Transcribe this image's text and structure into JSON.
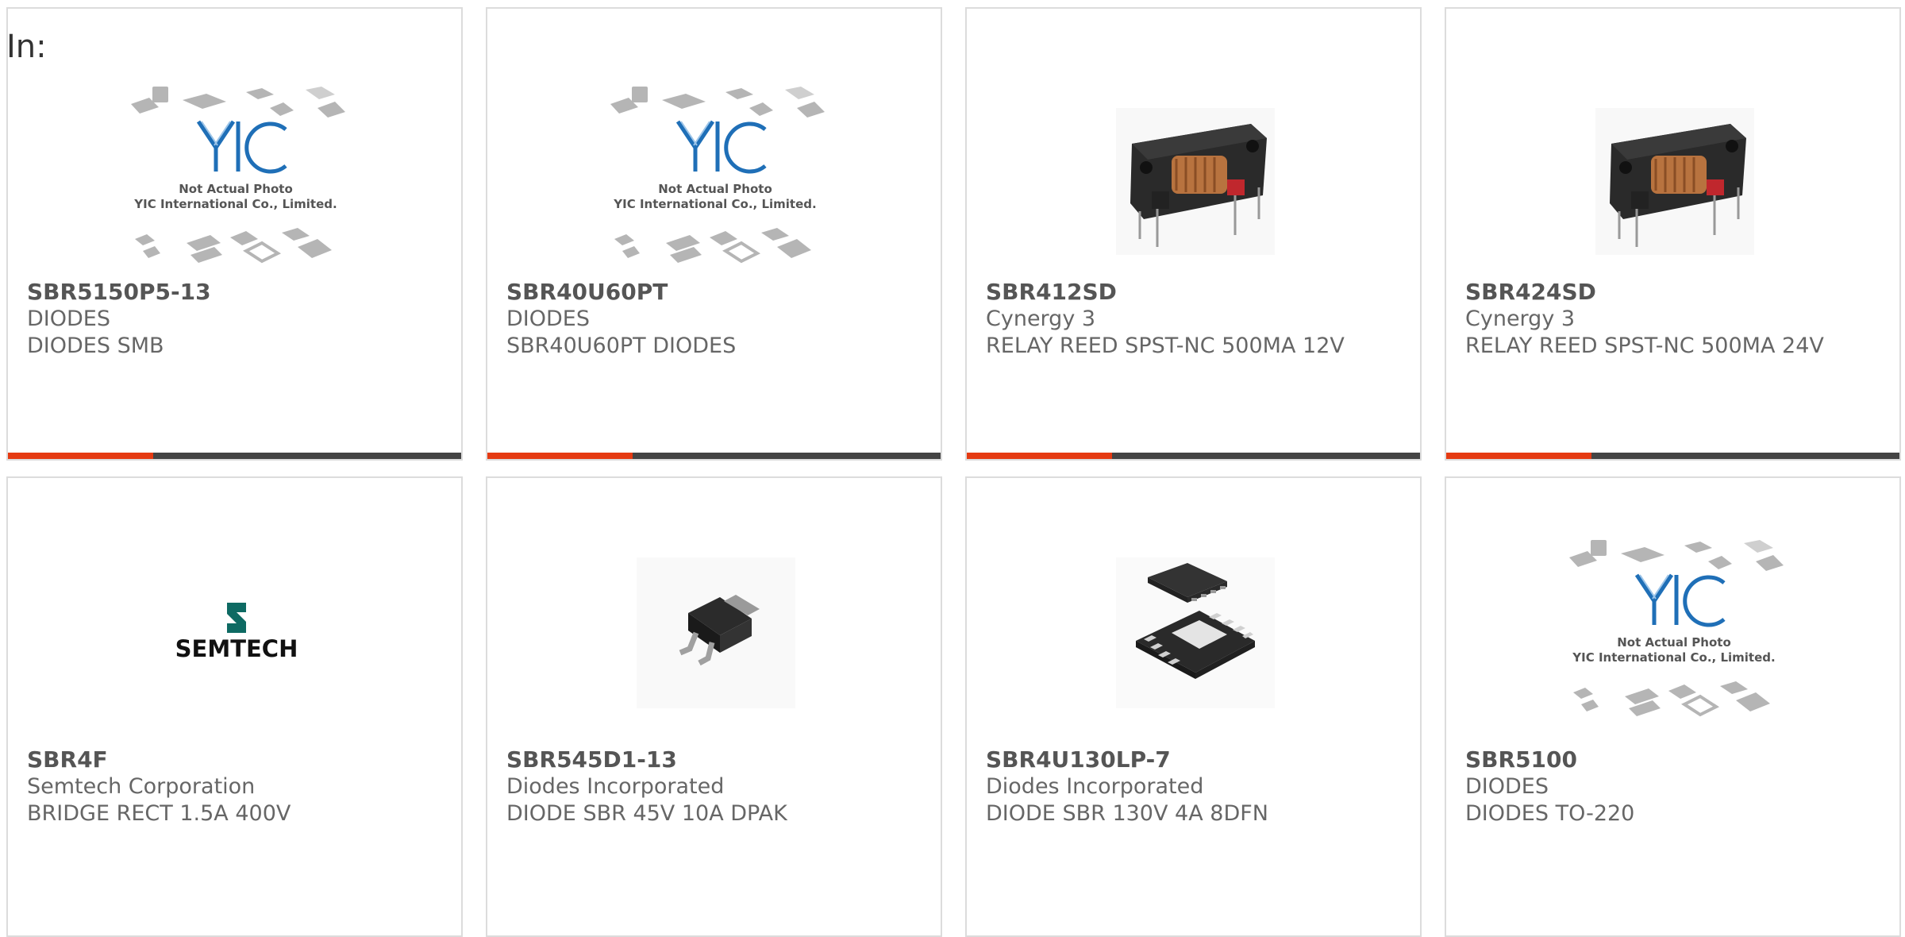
{
  "header": {
    "in_label": "In:"
  },
  "placeholder": {
    "line1": "Not Actual Photo",
    "line2": "YIC International Co., Limited."
  },
  "colors": {
    "accent": "#e53a12",
    "bar": "#444444",
    "border": "#dcdcdc",
    "yic_blue": "#1f6fb7"
  },
  "products": [
    {
      "part": "SBR5150P5-13",
      "manufacturer": "DIODES",
      "description": "DIODES SMB",
      "image": "yic-placeholder-icon"
    },
    {
      "part": "SBR40U60PT",
      "manufacturer": "DIODES",
      "description": "SBR40U60PT DIODES",
      "image": "yic-placeholder-icon"
    },
    {
      "part": "SBR412SD",
      "manufacturer": "Cynergy 3",
      "description": "RELAY REED SPST-NC 500MA 12V",
      "image": "reed-relay-icon"
    },
    {
      "part": "SBR424SD",
      "manufacturer": "Cynergy 3",
      "description": "RELAY REED SPST-NC 500MA 24V",
      "image": "reed-relay-icon"
    },
    {
      "part": "SBR4F",
      "manufacturer": "Semtech Corporation",
      "description": "BRIDGE RECT 1.5A 400V",
      "image": "semtech-logo",
      "logo_text": "SEMTECH"
    },
    {
      "part": "SBR545D1-13",
      "manufacturer": "Diodes Incorporated",
      "description": "DIODE SBR 45V 10A DPAK",
      "image": "dpak-package-icon"
    },
    {
      "part": "SBR4U130LP-7",
      "manufacturer": "Diodes Incorporated",
      "description": "DIODE SBR 130V 4A 8DFN",
      "image": "dfn-package-icon"
    },
    {
      "part": "SBR5100",
      "manufacturer": "DIODES",
      "description": "DIODES TO-220",
      "image": "yic-placeholder-icon"
    }
  ]
}
